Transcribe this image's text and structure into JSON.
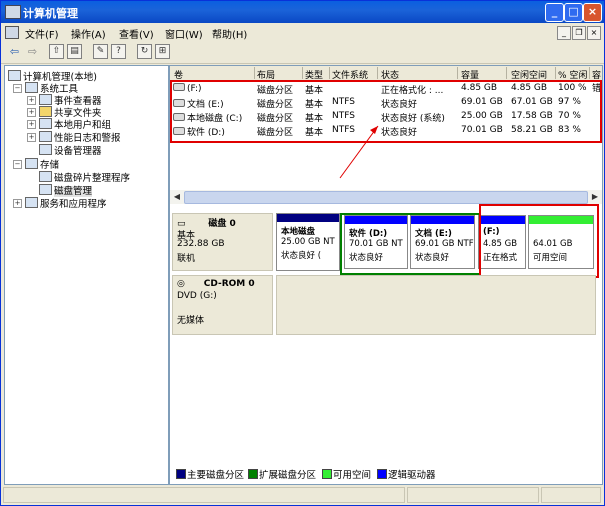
{
  "window": {
    "title": "计算机管理",
    "buttons": {
      "minimize": "_",
      "maximize": "□",
      "close": "×"
    }
  },
  "menu": [
    "文件(F)",
    "操作(A)",
    "查看(V)",
    "窗口(W)",
    "帮助(H)"
  ],
  "mdi": {
    "minimize": "_",
    "restore": "❐",
    "close": "×"
  },
  "toolbar": [
    "back-icon",
    "forward-icon",
    "up-folder-icon",
    "show-tree-icon",
    "properties-icon",
    "help-icon",
    "refresh-icon",
    "export-icon"
  ],
  "tree": {
    "root": "计算机管理(本地)",
    "system_tools": "系统工具",
    "event_viewer": "事件查看器",
    "shared_folders": "共享文件夹",
    "local_users": "本地用户和组",
    "perf_logs": "性能日志和警报",
    "device_manager": "设备管理器",
    "storage": "存储",
    "defrag": "磁盘碎片整理程序",
    "disk_mgmt": "磁盘管理",
    "services_apps": "服务和应用程序"
  },
  "columns": [
    "卷",
    "布局",
    "类型",
    "文件系统",
    "状态",
    "容量",
    "空闲空间",
    "% 空闲",
    "容错"
  ],
  "volumes": [
    {
      "name": "(F:)",
      "layout": "磁盘分区",
      "type": "基本",
      "fs": "",
      "status": "正在格式化 : ...",
      "capacity": "4.85 GB",
      "free": "4.85 GB",
      "pct": "100 %"
    },
    {
      "name": "文档 (E:)",
      "layout": "磁盘分区",
      "type": "基本",
      "fs": "NTFS",
      "status": "状态良好",
      "capacity": "69.01 GB",
      "free": "67.01 GB",
      "pct": "97 %"
    },
    {
      "name": "本地磁盘 (C:)",
      "layout": "磁盘分区",
      "type": "基本",
      "fs": "NTFS",
      "status": "状态良好 (系统)",
      "capacity": "25.00 GB",
      "free": "17.58 GB",
      "pct": "70 %"
    },
    {
      "name": "软件 (D:)",
      "layout": "磁盘分区",
      "type": "基本",
      "fs": "NTFS",
      "status": "状态良好",
      "capacity": "70.01 GB",
      "free": "58.21 GB",
      "pct": "83 %"
    }
  ],
  "disk0": {
    "name": "磁盘 0",
    "type": "基本",
    "size": "232.88 GB",
    "status": "联机",
    "partitions": [
      {
        "title": "本地磁盘",
        "size": "25.00 GB NT",
        "status": "状态良好 (",
        "color": "#000080"
      },
      {
        "title": "软件  (D:)",
        "size": "70.01 GB NT",
        "status": "状态良好",
        "color": "#0000ff"
      },
      {
        "title": "文档  (E:)",
        "size": "69.01 GB NTF",
        "status": "状态良好",
        "color": "#0000ff"
      },
      {
        "title": "(F:)",
        "size": "4.85 GB",
        "status": "正在格式",
        "color": "#0000ff"
      },
      {
        "title": "",
        "size": "64.01 GB",
        "status": "可用空间",
        "color": "#33ee33"
      }
    ]
  },
  "cdrom": {
    "name": "CD-ROM 0",
    "drive": "DVD (G:)",
    "status": "无媒体"
  },
  "legend": [
    {
      "label": "主要磁盘分区",
      "color": "#000080"
    },
    {
      "label": "扩展磁盘分区",
      "color": "#008000"
    },
    {
      "label": "可用空间",
      "color": "#33ee33"
    },
    {
      "label": "逻辑驱动器",
      "color": "#0000ff"
    }
  ],
  "colors": {
    "annotation_red": "#e00000",
    "extended_green": "#008000"
  }
}
